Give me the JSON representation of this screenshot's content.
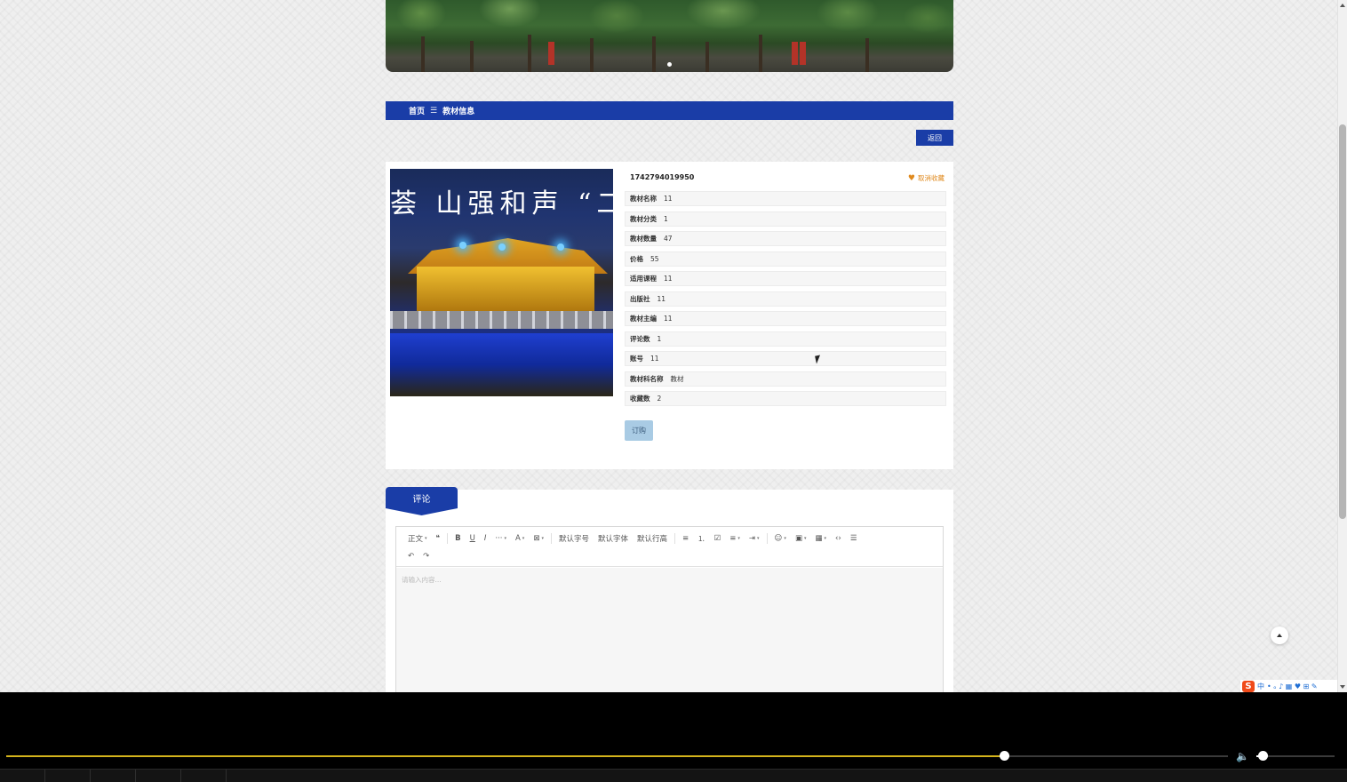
{
  "breadcrumb": {
    "home": "首页",
    "separator": "☰",
    "current": "教材信息"
  },
  "actions": {
    "back": "返回",
    "order": "订购",
    "favorite": "取消收藏"
  },
  "colors": {
    "primary": "#1a3da7",
    "favorite": "#e08a1e",
    "order_button": "#a9cbe4"
  },
  "item": {
    "id": "1742794019950",
    "fields": [
      {
        "label": "教材名称",
        "value": "11"
      },
      {
        "label": "教材分类",
        "value": "1"
      },
      {
        "label": "教材数量",
        "value": "47"
      },
      {
        "label": "价格",
        "value": "55"
      },
      {
        "label": "适用课程",
        "value": "11"
      },
      {
        "label": "出版社",
        "value": "11"
      },
      {
        "label": "教材主编",
        "value": "11"
      },
      {
        "label": "评论数",
        "value": "1"
      },
      {
        "label": "账号",
        "value": "11"
      },
      {
        "label": "教材科名称",
        "value": "教材"
      },
      {
        "label": "收藏数",
        "value": "2"
      }
    ]
  },
  "photo": {
    "calligraphy": "荟 山强和声 “二"
  },
  "comments": {
    "tab_label": "评论",
    "editor": {
      "toolbar_row1": [
        "正文",
        "❝",
        "B",
        "U",
        "I",
        "···",
        "A",
        "⊠",
        "默认字号",
        "默认字体",
        "默认行高",
        "≡",
        "⒈",
        "☑",
        "≡",
        "⇥",
        "☺",
        "▣",
        "▦",
        "‹›",
        "☰"
      ],
      "toolbar_row2": [
        "↶",
        "↷"
      ],
      "placeholder": "请输入内容..."
    }
  },
  "ime": {
    "logo": "S",
    "mode": "中",
    "icons": "• ₒ ♪ ▦ ♥ ⊞ ✎"
  },
  "player": {
    "progress": 0.817,
    "volume": 0.08
  }
}
